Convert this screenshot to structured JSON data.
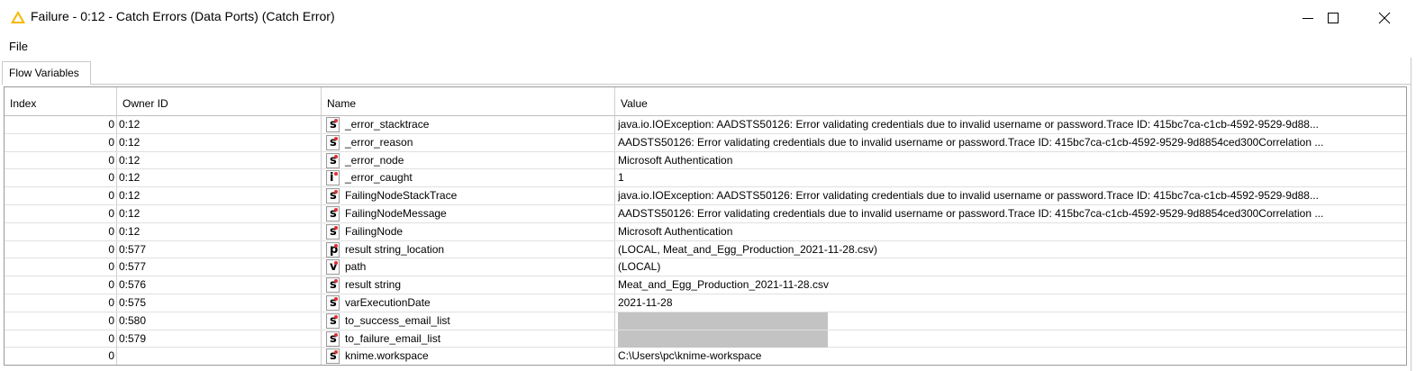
{
  "window": {
    "title": "Failure - 0:12 - Catch Errors (Data Ports) (Catch Error)",
    "icon": "warning-triangle-icon",
    "accent": "#f5b800"
  },
  "menu": {
    "file_label": "File"
  },
  "tabs": [
    {
      "label": "Flow Variables"
    }
  ],
  "table": {
    "columns": [
      "Index",
      "Owner ID",
      "Name",
      "Value"
    ],
    "rows": [
      {
        "index": "0",
        "owner": "0:12",
        "type": "s",
        "name": "_error_stacktrace",
        "value": "java.io.IOException: AADSTS50126: Error validating credentials due to invalid username or password.Trace ID: 415bc7ca-c1cb-4592-9529-9d88...",
        "redacted": false
      },
      {
        "index": "0",
        "owner": "0:12",
        "type": "s",
        "name": "_error_reason",
        "value": "AADSTS50126: Error validating credentials due to invalid username or password.Trace ID: 415bc7ca-c1cb-4592-9529-9d8854ced300Correlation ...",
        "redacted": false
      },
      {
        "index": "0",
        "owner": "0:12",
        "type": "s",
        "name": "_error_node",
        "value": "Microsoft Authentication",
        "redacted": false
      },
      {
        "index": "0",
        "owner": "0:12",
        "type": "i",
        "name": "_error_caught",
        "value": "1",
        "redacted": false
      },
      {
        "index": "0",
        "owner": "0:12",
        "type": "s",
        "name": "FailingNodeStackTrace",
        "value": "java.io.IOException: AADSTS50126: Error validating credentials due to invalid username or password.Trace ID: 415bc7ca-c1cb-4592-9529-9d88...",
        "redacted": false
      },
      {
        "index": "0",
        "owner": "0:12",
        "type": "s",
        "name": "FailingNodeMessage",
        "value": "AADSTS50126: Error validating credentials due to invalid username or password.Trace ID: 415bc7ca-c1cb-4592-9529-9d8854ced300Correlation ...",
        "redacted": false
      },
      {
        "index": "0",
        "owner": "0:12",
        "type": "s",
        "name": "FailingNode",
        "value": "Microsoft Authentication",
        "redacted": false
      },
      {
        "index": "0",
        "owner": "0:577",
        "type": "p",
        "name": "result string_location",
        "value": "(LOCAL, Meat_and_Egg_Production_2021-11-28.csv)",
        "redacted": false
      },
      {
        "index": "0",
        "owner": "0:577",
        "type": "v",
        "name": "path",
        "value": "(LOCAL)",
        "redacted": false
      },
      {
        "index": "0",
        "owner": "0:576",
        "type": "s",
        "name": "result string",
        "value": "Meat_and_Egg_Production_2021-11-28.csv",
        "redacted": false
      },
      {
        "index": "0",
        "owner": "0:575",
        "type": "s",
        "name": "varExecutionDate",
        "value": "2021-11-28",
        "redacted": false
      },
      {
        "index": "0",
        "owner": "0:580",
        "type": "s",
        "name": "to_success_email_list",
        "value": "",
        "redacted": true
      },
      {
        "index": "0",
        "owner": "0:579",
        "type": "s",
        "name": "to_failure_email_list",
        "value": "",
        "redacted": true
      },
      {
        "index": "0",
        "owner": "",
        "type": "s",
        "name": "knime.workspace",
        "value": "C:\\Users\\pc\\knime-workspace",
        "redacted": false
      }
    ]
  }
}
